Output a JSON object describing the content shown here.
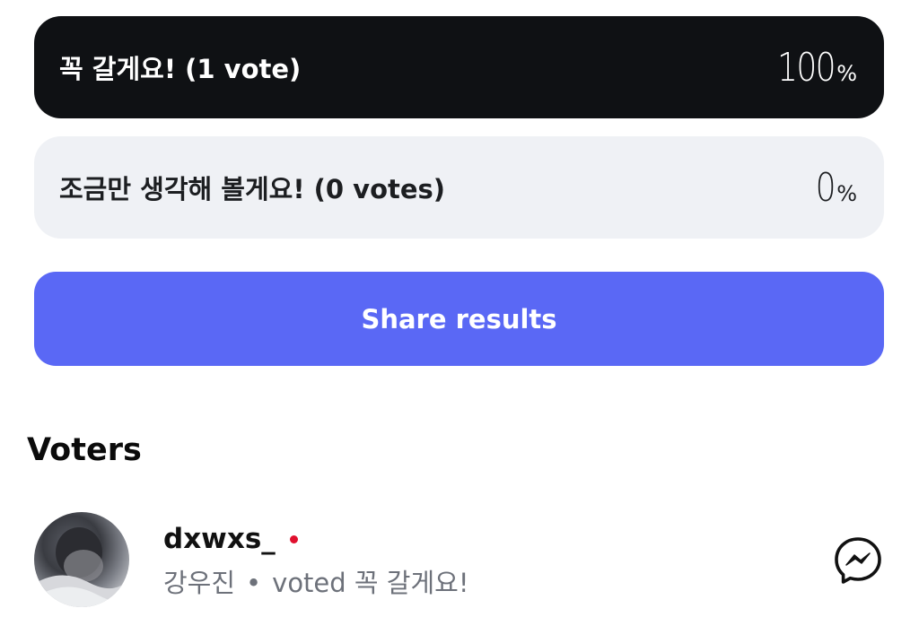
{
  "poll": {
    "options": [
      {
        "label": "꼭 갈게요! (1 vote)",
        "percent": "100",
        "percent_sign": "%",
        "share": 1.0
      },
      {
        "label": "조금만 생각해 볼게요! (0 votes)",
        "percent": "0",
        "percent_sign": "%",
        "share": 0.0
      }
    ],
    "share_button_label": "Share results"
  },
  "voters": {
    "title": "Voters",
    "items": [
      {
        "username": "dxwxs_",
        "display_name": "강우진",
        "separator": "•",
        "vote_text": "voted 꼭 갈게요!",
        "online": true
      }
    ]
  },
  "colors": {
    "selected_option_bg": "#0f1114",
    "unselected_option_bg": "#eff1f5",
    "share_button_bg": "#5a68f5",
    "online_dot": "#e0102e",
    "secondary_text": "#6d717a"
  },
  "icons": {
    "message": "messenger-icon"
  }
}
